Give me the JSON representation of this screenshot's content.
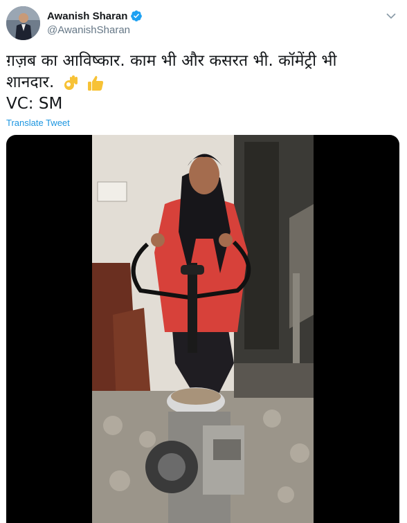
{
  "author": {
    "display_name": "Awanish Sharan",
    "handle": "@AwanishSharan",
    "verified": true,
    "avatar_icon": "profile-photo"
  },
  "menu_icon": "chevron-down-icon",
  "tweet": {
    "line1": "ग़ज़ब का आविष्कार. काम भी और कसरत भी. कॉमेंट्री भी",
    "line2": "शानदार.",
    "line3": "VC: SM",
    "emojis": [
      "ok-hand-emoji",
      "thumbs-up-emoji"
    ]
  },
  "translate_label": "Translate Tweet",
  "media": {
    "type": "video",
    "description_icon": "video-frame",
    "colors": {
      "background": "#000000",
      "accent": "#1b95e0"
    }
  }
}
